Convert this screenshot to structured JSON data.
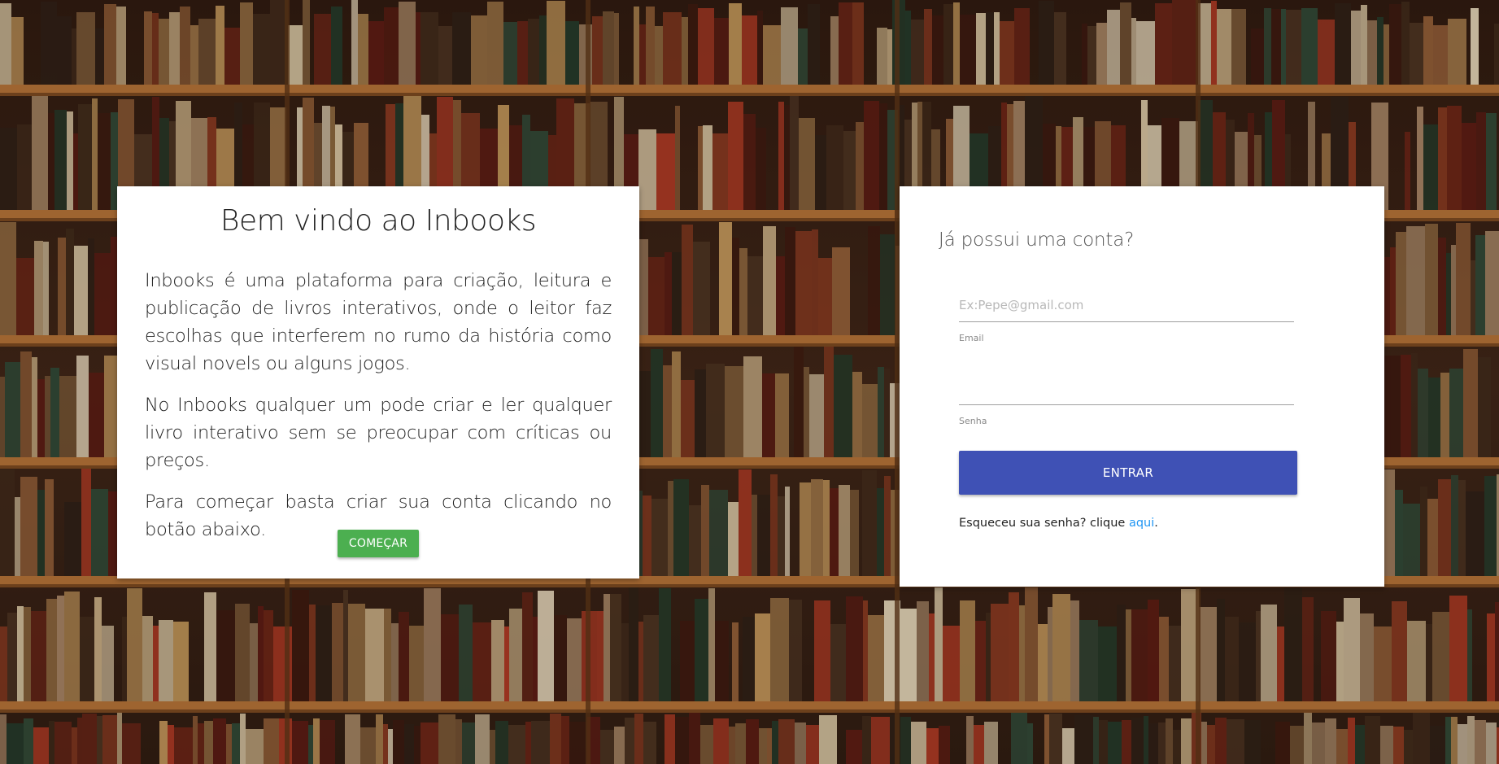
{
  "welcome": {
    "title": "Bem vindo ao Inbooks",
    "paragraph1": "Inbooks é uma plataforma para criação, leitura e publicação de livros interativos, onde o leitor faz escolhas que interferem no rumo da história como visual novels ou alguns jogos.",
    "paragraph2": "No Inbooks qualquer um pode criar e ler qualquer livro interativo sem se preocupar com críticas ou preços.",
    "paragraph3": "Para começar basta criar sua conta clicando no botão abaixo.",
    "start_button": "COMEÇAR"
  },
  "login": {
    "title": "Já possui uma conta?",
    "email": {
      "placeholder": "Ex:Pepe@gmail.com",
      "value": "",
      "label": "Email"
    },
    "password": {
      "placeholder": "",
      "value": "",
      "label": "Senha"
    },
    "submit_button": "ENTRAR",
    "forgot_text": "Esqueceu sua senha? clique ",
    "forgot_link": "aqui",
    "forgot_suffix": "."
  },
  "colors": {
    "start_button": "#4caf50",
    "submit_button": "#3f51b5",
    "link": "#2196f3"
  }
}
